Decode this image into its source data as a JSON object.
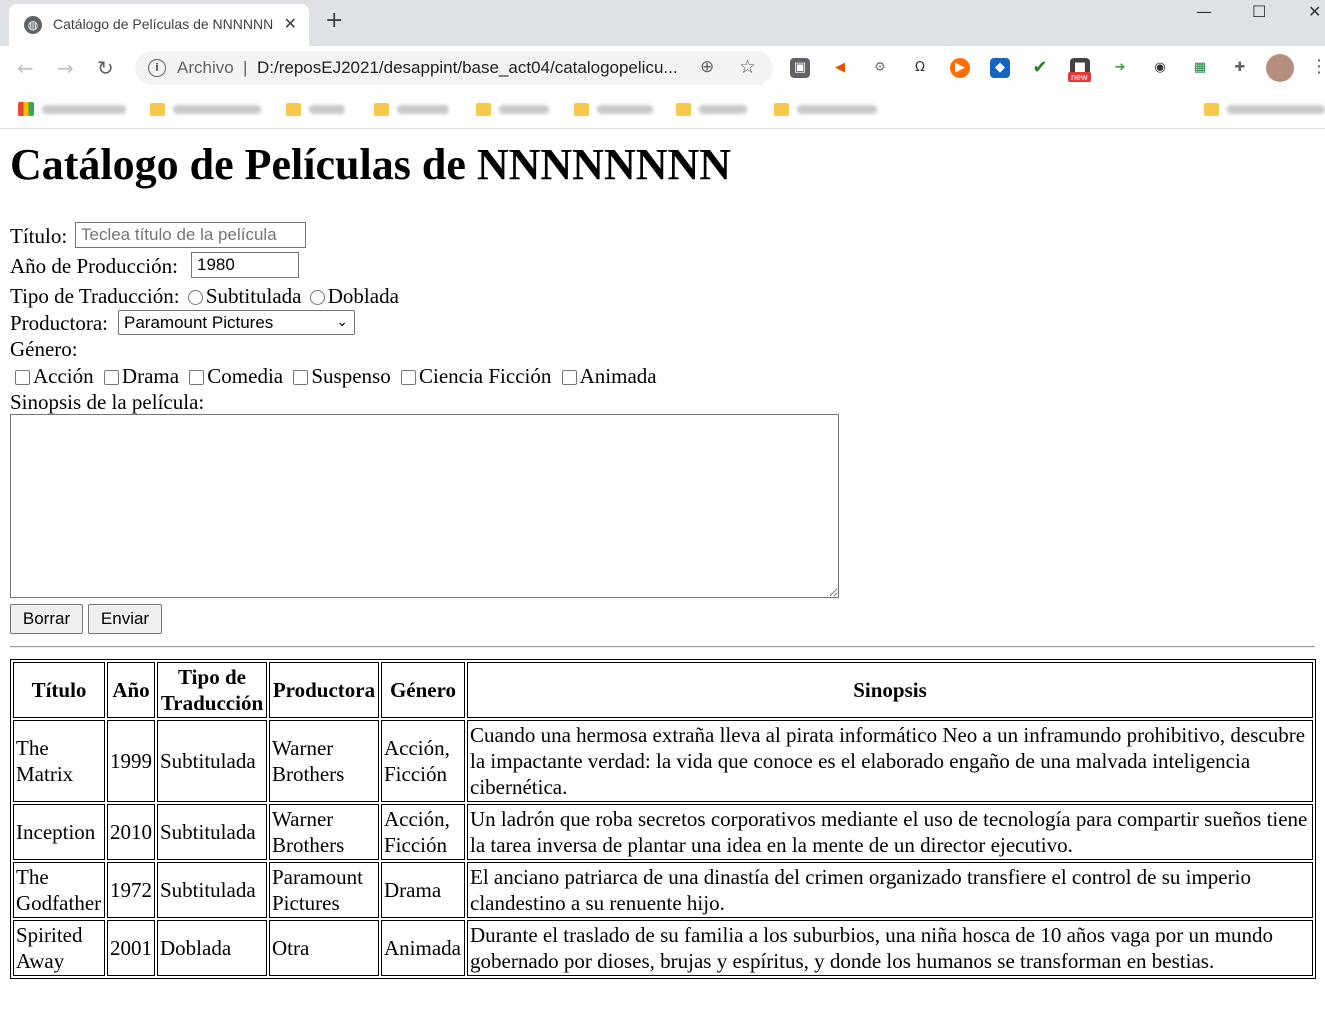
{
  "browser": {
    "tab_title": "Catálogo de Películas de NNNNNNNNN",
    "tab_close": "✕",
    "new_tab": "+",
    "window_controls": [
      "—",
      "☐",
      "✕"
    ],
    "omnibox": {
      "scheme_label": "Archivo",
      "separator": "|",
      "url": "D:/reposEJ2021/desappint/base_act04/catalogopelicu..."
    },
    "extension_badge": "new",
    "icons": [
      "back-arrow-icon",
      "forward-arrow-icon",
      "reload-icon",
      "info-icon",
      "zoom-icon",
      "bookmark-star-icon",
      "extensions-puzzle-icon",
      "profile-avatar",
      "more-menu-icon"
    ]
  },
  "page": {
    "title": "Catálogo de Películas de NNNNNNNN",
    "form": {
      "titulo_label": "Título:",
      "titulo_placeholder": "Teclea título de la película",
      "anio_label": "Año de Producción:",
      "anio_value": "1980",
      "tipo_label": "Tipo de Traducción:",
      "tipo_options": [
        "Subtitulada",
        "Doblada"
      ],
      "productora_label": "Productora:",
      "productora_selected": "Paramount Pictures",
      "genero_label": "Género:",
      "genero_options": [
        "Acción",
        "Drama",
        "Comedia",
        "Suspenso",
        "Ciencia Ficción",
        "Animada"
      ],
      "sinopsis_label": "Sinopsis de la película:",
      "borrar_label": "Borrar",
      "enviar_label": "Enviar"
    },
    "table": {
      "headers": [
        "Título",
        "Año",
        "Tipo de Traducción",
        "Productora",
        "Género",
        "Sinopsis"
      ],
      "rows": [
        [
          "The Matrix",
          "1999",
          "Subtitulada",
          "Warner Brothers",
          "Acción, Ficción",
          "Cuando una hermosa extraña lleva al pirata informático Neo a un inframundo prohibitivo, descubre la impactante verdad: la vida que conoce es el elaborado engaño de una malvada inteligencia cibernética."
        ],
        [
          "Inception",
          "2010",
          "Subtitulada",
          "Warner Brothers",
          "Acción, Ficción",
          "Un ladrón que roba secretos corporativos mediante el uso de tecnología para compartir sueños tiene la tarea inversa de plantar una idea en la mente de un director ejecutivo."
        ],
        [
          "The Godfather",
          "1972",
          "Subtitulada",
          "Paramount Pictures",
          "Drama",
          "El anciano patriarca de una dinastía del crimen organizado transfiere el control de su imperio clandestino a su renuente hijo."
        ],
        [
          "Spirited Away",
          "2001",
          "Doblada",
          "Otra",
          "Animada",
          "Durante el traslado de su familia a los suburbios, una niña hosca de 10 años vaga por un mundo gobernado por dioses, brujas y espíritus, y donde los humanos se transforman en bestias."
        ]
      ]
    }
  }
}
